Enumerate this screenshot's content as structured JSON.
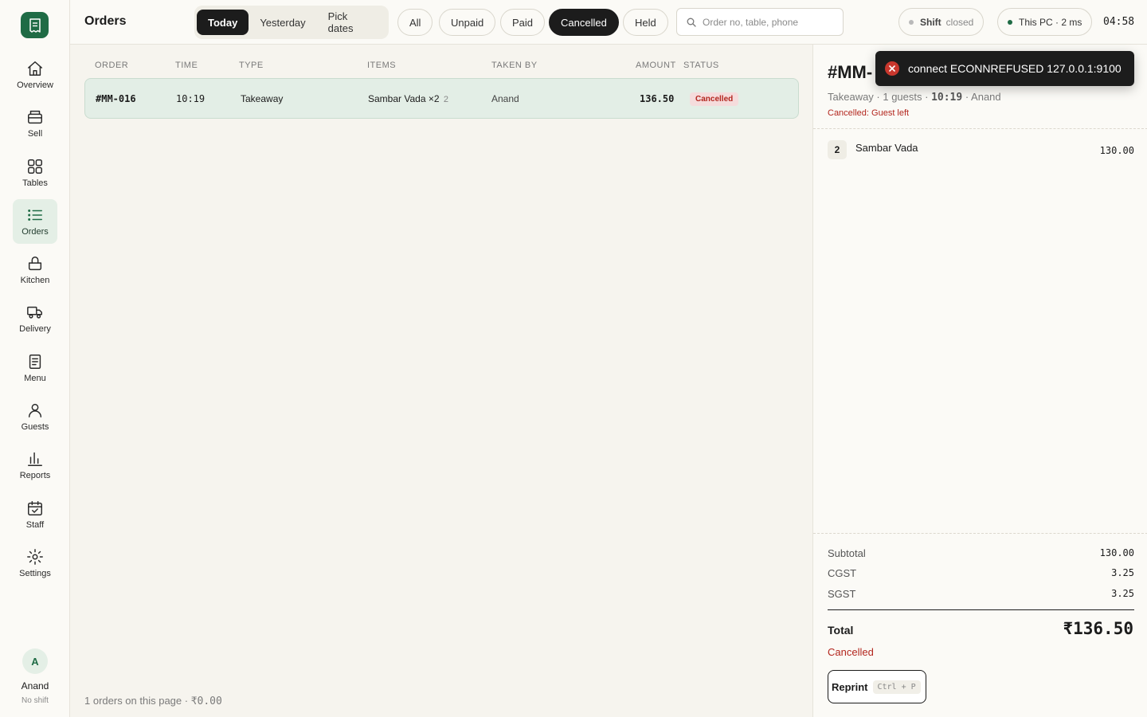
{
  "sidebar": {
    "items": [
      {
        "label": "Overview",
        "icon": "home-icon"
      },
      {
        "label": "Sell",
        "icon": "register-icon"
      },
      {
        "label": "Tables",
        "icon": "grid-icon"
      },
      {
        "label": "Orders",
        "icon": "list-icon",
        "active": true
      },
      {
        "label": "Kitchen",
        "icon": "pot-icon"
      },
      {
        "label": "Delivery",
        "icon": "truck-icon"
      },
      {
        "label": "Menu",
        "icon": "menu-icon"
      },
      {
        "label": "Guests",
        "icon": "person-icon"
      },
      {
        "label": "Reports",
        "icon": "bar-chart-icon"
      },
      {
        "label": "Staff",
        "icon": "calendar-check-icon"
      },
      {
        "label": "Settings",
        "icon": "gear-icon"
      }
    ],
    "user": {
      "initial": "A",
      "name": "Anand",
      "shift": "No shift"
    }
  },
  "header": {
    "title": "Orders",
    "date_tabs": [
      "Today",
      "Yesterday",
      "Pick dates"
    ],
    "active_date_tab": "Today",
    "filters": [
      "All",
      "Unpaid",
      "Paid",
      "Cancelled",
      "Held"
    ],
    "active_filter": "Cancelled",
    "search_placeholder": "Order no, table, phone",
    "shift_label": "Shift",
    "shift_status": "closed",
    "connection": "This PC · 2 ms",
    "clock": "04:58"
  },
  "table": {
    "columns": [
      "ORDER",
      "TIME",
      "TYPE",
      "ITEMS",
      "TAKEN BY",
      "AMOUNT",
      "STATUS"
    ],
    "rows": [
      {
        "order": "#MM-016",
        "time": "10:19",
        "type": "Takeaway",
        "items": "Sambar Vada ×2",
        "item_count": "2",
        "taken_by": "Anand",
        "amount": "136.50",
        "status": "Cancelled"
      }
    ],
    "footer_text": "1 orders on this page · ",
    "footer_amount": "₹0.00"
  },
  "detail": {
    "title": "#MM-",
    "meta_prefix": "Takeaway · 1 guests · ",
    "meta_time": "10:19",
    "meta_suffix": " · Anand",
    "reason": "Cancelled: Guest left",
    "line_items": [
      {
        "qty": "2",
        "name": "Sambar Vada",
        "amount": "130.00"
      }
    ],
    "subtotal_label": "Subtotal",
    "subtotal": "130.00",
    "cgst_label": "CGST",
    "cgst": "3.25",
    "sgst_label": "SGST",
    "sgst": "3.25",
    "total_label": "Total",
    "total": "₹136.50",
    "status": "Cancelled",
    "reprint_label": "Reprint",
    "reprint_shortcut": "Ctrl + P"
  },
  "toast": {
    "message": "connect ECONNREFUSED 127.0.0.1:9100"
  },
  "colors": {
    "brand": "#1f6b45",
    "danger": "#b3261e",
    "active_chip": "#1c1c1c",
    "selected_row": "#e3eee6"
  }
}
